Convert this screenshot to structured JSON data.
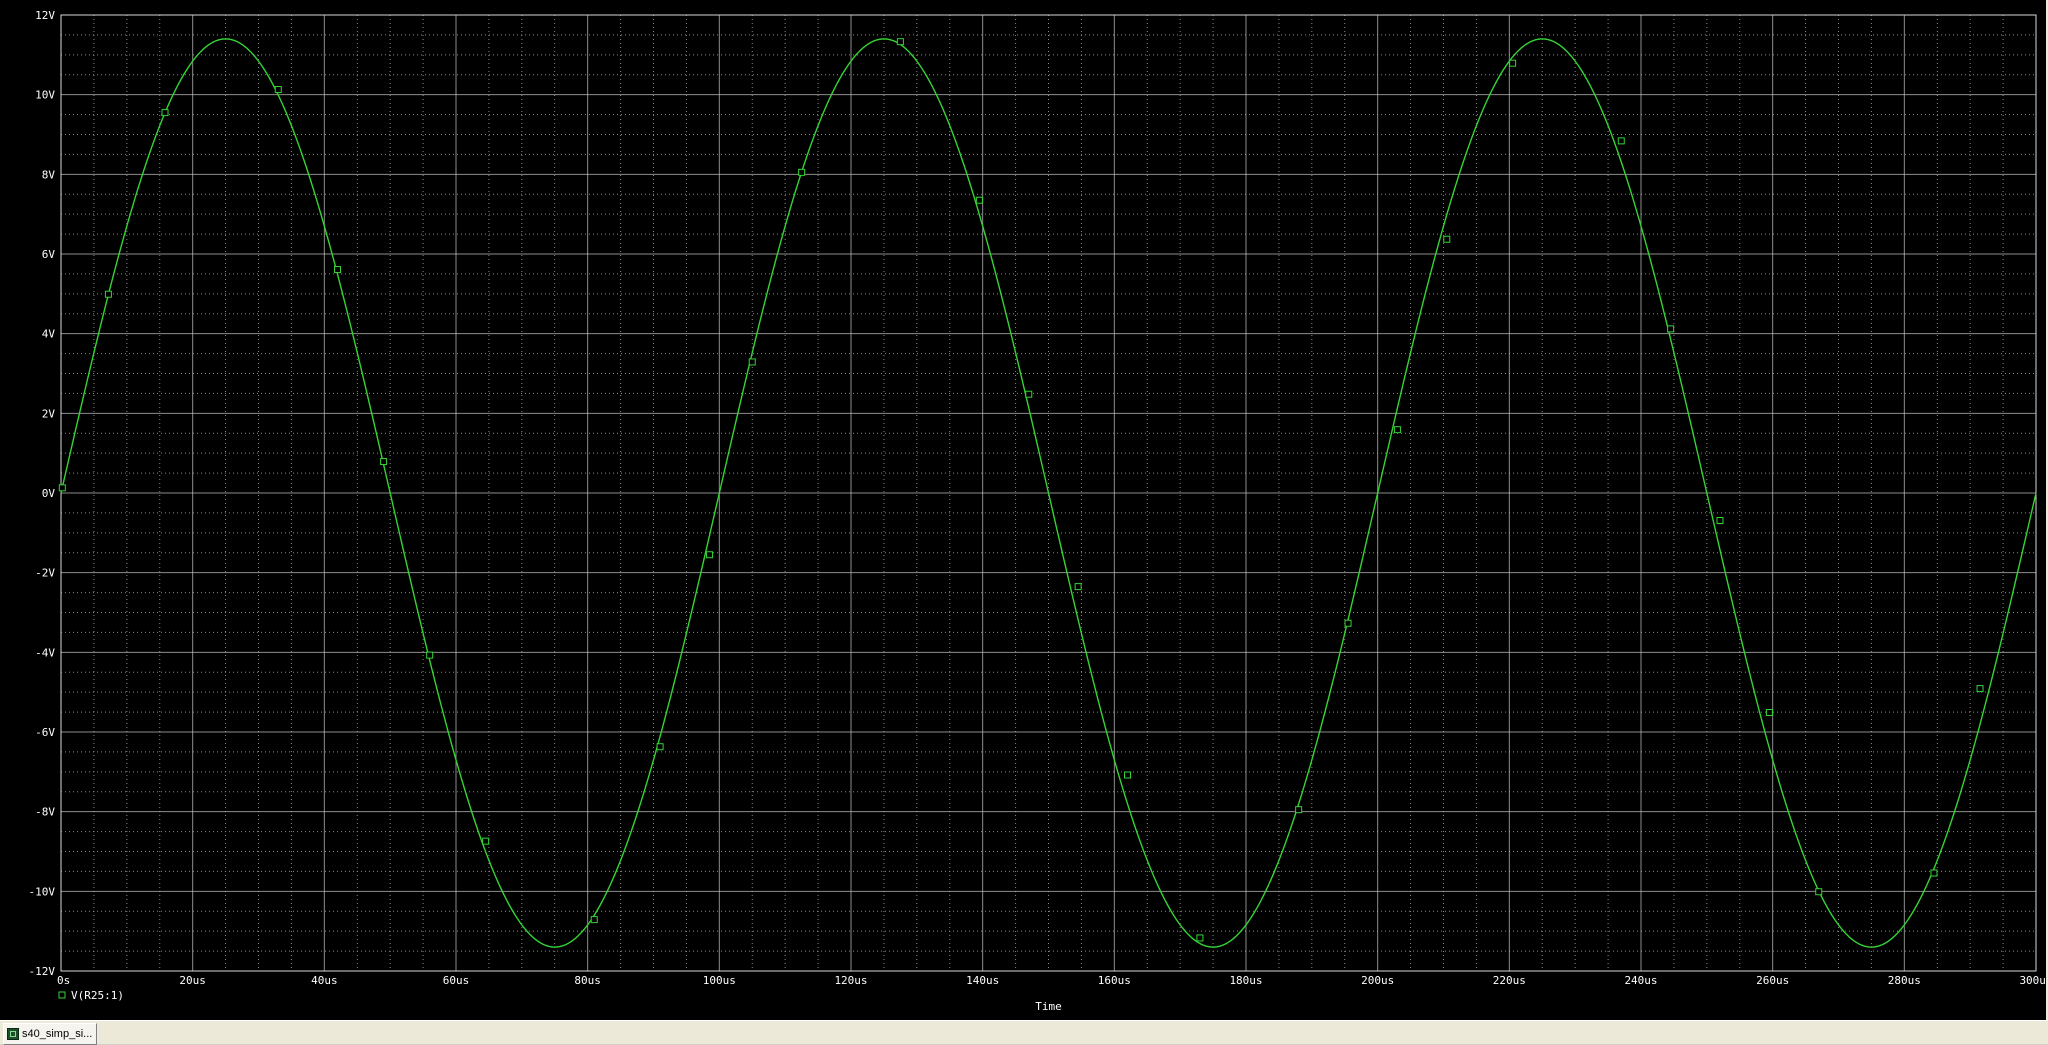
{
  "chart_data": {
    "type": "line",
    "title": "",
    "xlabel": "Time",
    "ylabel": "",
    "x_unit": "us",
    "xlim": [
      0,
      300
    ],
    "ylim": [
      -12,
      12
    ],
    "x_ticks": [
      0,
      20,
      40,
      60,
      80,
      100,
      120,
      140,
      160,
      180,
      200,
      220,
      240,
      260,
      280,
      300
    ],
    "x_tick_labels": [
      "0s",
      "20us",
      "40us",
      "60us",
      "80us",
      "100us",
      "120us",
      "140us",
      "160us",
      "180us",
      "200us",
      "220us",
      "240us",
      "260us",
      "280us",
      "300us"
    ],
    "y_ticks": [
      12,
      10,
      8,
      6,
      4,
      2,
      0,
      -2,
      -4,
      -6,
      -8,
      -10,
      -12
    ],
    "y_tick_labels": [
      "12V",
      "10V",
      "8V",
      "6V",
      "4V",
      "2V",
      "0V",
      "-2V",
      "-4V",
      "-6V",
      "-8V",
      "-10V",
      "-12V"
    ],
    "grid": true,
    "minor_grid": true,
    "background": "#000000",
    "grid_color": "#bdbdbd",
    "legend_position": "bottom-left",
    "series": [
      {
        "name": "V(R25:1)",
        "color": "#35d335",
        "marker": "square",
        "x": [
          0,
          5,
          10,
          15,
          20,
          25,
          30,
          35,
          40,
          45,
          50,
          55,
          60,
          65,
          70,
          75,
          80,
          85,
          90,
          95,
          100,
          105,
          110,
          115,
          120,
          125,
          130,
          135,
          140,
          145,
          150,
          155,
          160,
          165,
          170,
          175,
          180,
          185,
          190,
          195,
          200,
          205,
          210,
          215,
          220,
          225,
          230,
          235,
          240,
          245,
          250,
          255,
          260,
          265,
          270,
          275,
          280,
          285,
          290,
          295,
          300
        ],
        "y": [
          0.0,
          3.5,
          6.7,
          9.2,
          10.8,
          11.4,
          10.8,
          9.2,
          6.7,
          3.5,
          0.0,
          -3.5,
          -6.7,
          -9.2,
          -10.8,
          -11.4,
          -10.8,
          -9.2,
          -6.7,
          -3.5,
          0.0,
          3.5,
          6.7,
          9.2,
          10.8,
          11.4,
          10.8,
          9.2,
          6.7,
          3.5,
          0.0,
          -3.5,
          -6.7,
          -9.2,
          -10.8,
          -11.4,
          -10.8,
          -9.2,
          -6.7,
          -3.5,
          0.0,
          3.5,
          6.7,
          9.2,
          10.8,
          11.4,
          10.8,
          9.2,
          6.7,
          3.5,
          0.0,
          -3.5,
          -6.7,
          -9.2,
          -10.8,
          -11.4,
          -10.8,
          -9.2,
          -6.7,
          -3.5,
          0.0
        ],
        "marker_x": [
          0.2,
          7.2,
          15.8,
          33.0,
          42.0,
          49.0,
          56.0,
          64.5,
          81.0,
          91.0,
          98.5,
          105.0,
          112.5,
          127.5,
          139.5,
          147.0,
          154.5,
          162.0,
          173.0,
          188.0,
          195.5,
          203.0,
          210.5,
          220.5,
          237.0,
          244.5,
          252.0,
          259.5,
          267.0,
          284.5,
          291.5
        ],
        "marker_y": [
          0.13,
          4.99,
          9.55,
          10.13,
          5.61,
          0.79,
          -4.07,
          -8.74,
          -10.71,
          -6.37,
          -1.55,
          3.29,
          8.05,
          11.33,
          7.35,
          2.48,
          -2.35,
          -7.08,
          -11.17,
          -7.95,
          -3.27,
          1.59,
          6.37,
          10.79,
          8.84,
          4.12,
          -0.69,
          -5.51,
          -10.01,
          -9.54,
          -4.91
        ]
      }
    ]
  },
  "legend": {
    "label": "V(R25:1)"
  },
  "taskbar": {
    "tab_label": "s40_simp_si..."
  }
}
